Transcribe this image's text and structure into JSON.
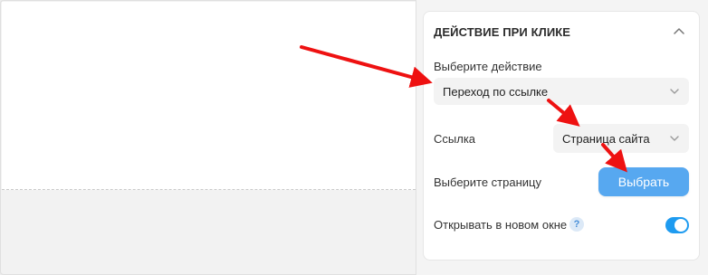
{
  "section": {
    "title": "ДЕЙСТВИЕ ПРИ КЛИКЕ",
    "collapse_icon": "chevron-up-icon"
  },
  "action": {
    "label": "Выберите действие",
    "value": "Переход по ссылке",
    "icon": "chevron-down-icon"
  },
  "link": {
    "label": "Ссылка",
    "value": "Страница сайта",
    "icon": "chevron-down-icon"
  },
  "page": {
    "label": "Выберите страницу",
    "button_label": "Выбрать"
  },
  "new_window": {
    "label": "Открывать в новом окне",
    "help_glyph": "?",
    "enabled": true
  },
  "colors": {
    "accent": "#57a8f0",
    "toggle_on": "#1e9bf0",
    "annotation_arrow": "#ee1111"
  }
}
